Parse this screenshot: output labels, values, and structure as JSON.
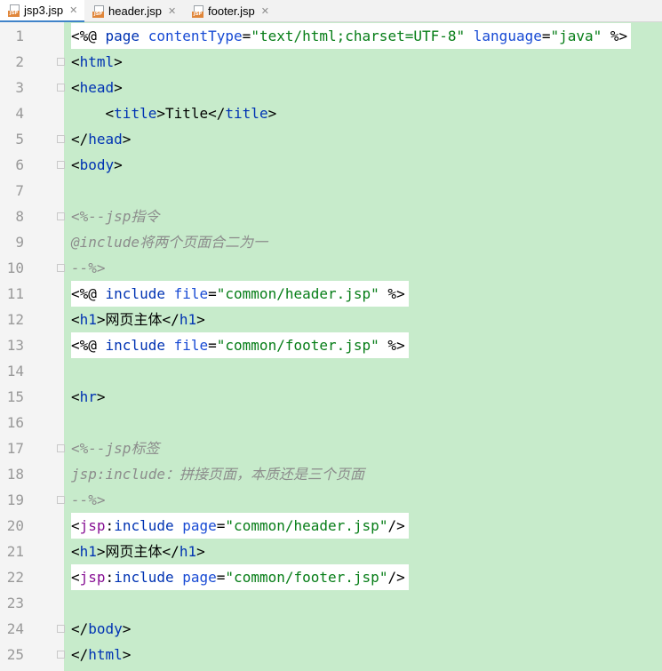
{
  "tabs": [
    {
      "label": "jsp3.jsp",
      "active": true,
      "icon": "jsp-file-icon"
    },
    {
      "label": "header.jsp",
      "active": false,
      "icon": "jsp-file-icon"
    },
    {
      "label": "footer.jsp",
      "active": false,
      "icon": "jsp-file-icon"
    }
  ],
  "colors": {
    "code_background": "#c7ebcb",
    "gutter_background": "#f4f4f4",
    "keyword": "#0033b3",
    "string": "#067d17",
    "comment": "#8c8c8c",
    "tag_prefix": "#871094"
  },
  "lines": [
    {
      "num": "1",
      "highlight": true,
      "tokens": [
        [
          "pl",
          "<%@ "
        ],
        [
          "k",
          "page "
        ],
        [
          "a",
          "contentType"
        ],
        [
          "pl",
          "="
        ],
        [
          "s",
          "\"text/html;charset=UTF-8\""
        ],
        [
          "pl",
          " "
        ],
        [
          "a",
          "language"
        ],
        [
          "pl",
          "="
        ],
        [
          "s",
          "\"java\""
        ],
        [
          "pl",
          " %>"
        ]
      ]
    },
    {
      "num": "2",
      "highlight": false,
      "fold": true,
      "tokens": [
        [
          "pl",
          "<"
        ],
        [
          "k",
          "html"
        ],
        [
          "pl",
          ">"
        ]
      ]
    },
    {
      "num": "3",
      "highlight": false,
      "fold": true,
      "tokens": [
        [
          "pl",
          "<"
        ],
        [
          "k",
          "head"
        ],
        [
          "pl",
          ">"
        ]
      ]
    },
    {
      "num": "4",
      "highlight": false,
      "tokens": [
        [
          "pl",
          "    <"
        ],
        [
          "k",
          "title"
        ],
        [
          "pl",
          ">Title</"
        ],
        [
          "k",
          "title"
        ],
        [
          "pl",
          ">"
        ]
      ]
    },
    {
      "num": "5",
      "highlight": false,
      "fold": true,
      "tokens": [
        [
          "pl",
          "</"
        ],
        [
          "k",
          "head"
        ],
        [
          "pl",
          ">"
        ]
      ]
    },
    {
      "num": "6",
      "highlight": false,
      "fold": true,
      "tokens": [
        [
          "pl",
          "<"
        ],
        [
          "k",
          "body"
        ],
        [
          "pl",
          ">"
        ]
      ]
    },
    {
      "num": "7",
      "highlight": false,
      "tokens": []
    },
    {
      "num": "8",
      "highlight": false,
      "fold": true,
      "tokens": [
        [
          "c",
          "<%--jsp指令"
        ]
      ]
    },
    {
      "num": "9",
      "highlight": false,
      "tokens": [
        [
          "c",
          "@include将两个页面合二为一"
        ]
      ]
    },
    {
      "num": "10",
      "highlight": false,
      "fold": true,
      "tokens": [
        [
          "c",
          "--%>"
        ]
      ]
    },
    {
      "num": "11",
      "highlight": true,
      "tokens": [
        [
          "pl",
          "<%@ "
        ],
        [
          "k",
          "include "
        ],
        [
          "a",
          "file"
        ],
        [
          "pl",
          "="
        ],
        [
          "s",
          "\"common/header.jsp\""
        ],
        [
          "pl",
          " %>"
        ]
      ]
    },
    {
      "num": "12",
      "highlight": false,
      "tokens": [
        [
          "pl",
          "<"
        ],
        [
          "k",
          "h1"
        ],
        [
          "pl",
          ">网页主体</"
        ],
        [
          "k",
          "h1"
        ],
        [
          "pl",
          ">"
        ]
      ]
    },
    {
      "num": "13",
      "highlight": true,
      "tokens": [
        [
          "pl",
          "<%@ "
        ],
        [
          "k",
          "include "
        ],
        [
          "a",
          "file"
        ],
        [
          "pl",
          "="
        ],
        [
          "s",
          "\"common/footer.jsp\""
        ],
        [
          "pl",
          " %>"
        ]
      ]
    },
    {
      "num": "14",
      "highlight": false,
      "tokens": []
    },
    {
      "num": "15",
      "highlight": false,
      "tokens": [
        [
          "pl",
          "<"
        ],
        [
          "k",
          "hr"
        ],
        [
          "pl",
          ">"
        ]
      ]
    },
    {
      "num": "16",
      "highlight": false,
      "tokens": []
    },
    {
      "num": "17",
      "highlight": false,
      "fold": true,
      "tokens": [
        [
          "c",
          "<%--jsp标签"
        ]
      ]
    },
    {
      "num": "18",
      "highlight": false,
      "tokens": [
        [
          "c",
          "jsp:include：拼接页面，本质还是三个页面"
        ]
      ]
    },
    {
      "num": "19",
      "highlight": false,
      "fold": true,
      "tokens": [
        [
          "c",
          "--%>"
        ]
      ]
    },
    {
      "num": "20",
      "highlight": true,
      "tokens": [
        [
          "pl",
          "<"
        ],
        [
          "p",
          "jsp"
        ],
        [
          "pl",
          ":"
        ],
        [
          "k",
          "include "
        ],
        [
          "a",
          "page"
        ],
        [
          "pl",
          "="
        ],
        [
          "s",
          "\"common/header.jsp\""
        ],
        [
          "pl",
          "/>"
        ]
      ]
    },
    {
      "num": "21",
      "highlight": false,
      "tokens": [
        [
          "pl",
          "<"
        ],
        [
          "k",
          "h1"
        ],
        [
          "pl",
          ">网页主体</"
        ],
        [
          "k",
          "h1"
        ],
        [
          "pl",
          ">"
        ]
      ]
    },
    {
      "num": "22",
      "highlight": true,
      "tokens": [
        [
          "pl",
          "<"
        ],
        [
          "p",
          "jsp"
        ],
        [
          "pl",
          ":"
        ],
        [
          "k",
          "include "
        ],
        [
          "a",
          "page"
        ],
        [
          "pl",
          "="
        ],
        [
          "s",
          "\"common/footer.jsp\""
        ],
        [
          "pl",
          "/>"
        ]
      ]
    },
    {
      "num": "23",
      "highlight": false,
      "tokens": []
    },
    {
      "num": "24",
      "highlight": false,
      "fold": true,
      "tokens": [
        [
          "pl",
          "</"
        ],
        [
          "k",
          "body"
        ],
        [
          "pl",
          ">"
        ]
      ]
    },
    {
      "num": "25",
      "highlight": false,
      "fold": true,
      "tokens": [
        [
          "pl",
          "</"
        ],
        [
          "k",
          "html"
        ],
        [
          "pl",
          ">"
        ]
      ]
    }
  ]
}
